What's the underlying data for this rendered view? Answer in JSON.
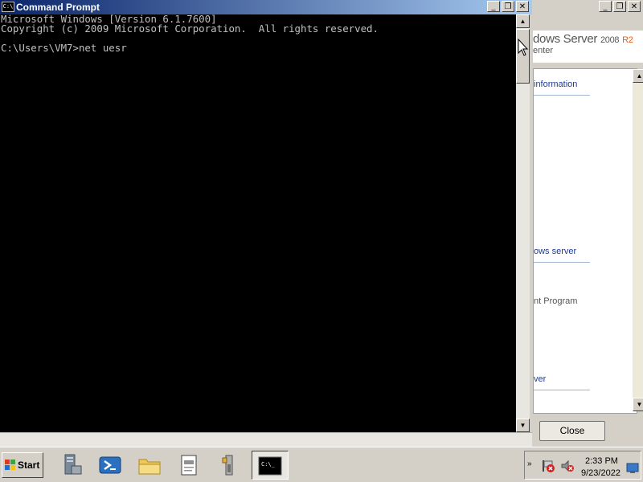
{
  "cmd_window": {
    "title": "Command Prompt",
    "icon_label": "C:\\",
    "console_lines": [
      "Microsoft Windows [Version 6.1.7600]",
      "Copyright (c) 2009 Microsoft Corporation.  All rights reserved.",
      "",
      "C:\\Users\\VM7>net uesr"
    ],
    "controls": {
      "minimize": "_",
      "maximize": "❐",
      "close": "✕"
    }
  },
  "bg_window": {
    "brand_partial": "dows Server",
    "brand_version": "2008",
    "brand_r2": "R2",
    "brand_sub_partial": "enter",
    "links": [
      {
        "text": "information"
      },
      {
        "text": "ows server"
      },
      {
        "text": "nt Program"
      },
      {
        "text": "ver"
      }
    ],
    "close_label": "Close",
    "controls": {
      "minimize": "_",
      "maximize": "❐",
      "close": "✕"
    }
  },
  "taskbar": {
    "start_label": "Start",
    "buttons": [
      {
        "name": "server-manager-icon"
      },
      {
        "name": "powershell-icon"
      },
      {
        "name": "explorer-folder-icon"
      },
      {
        "name": "notepad-icon"
      },
      {
        "name": "admin-tools-icon"
      },
      {
        "name": "command-prompt-icon",
        "label": "C:\\_",
        "active": true
      }
    ],
    "tray": {
      "chevron": "»",
      "time": "2:33 PM",
      "date": "9/23/2022"
    }
  },
  "colors": {
    "console_bg": "#000000",
    "console_text": "#c0c0c0",
    "title_active": "#0a246a",
    "link": "#1f3a8f",
    "r2_accent": "#e06020"
  }
}
